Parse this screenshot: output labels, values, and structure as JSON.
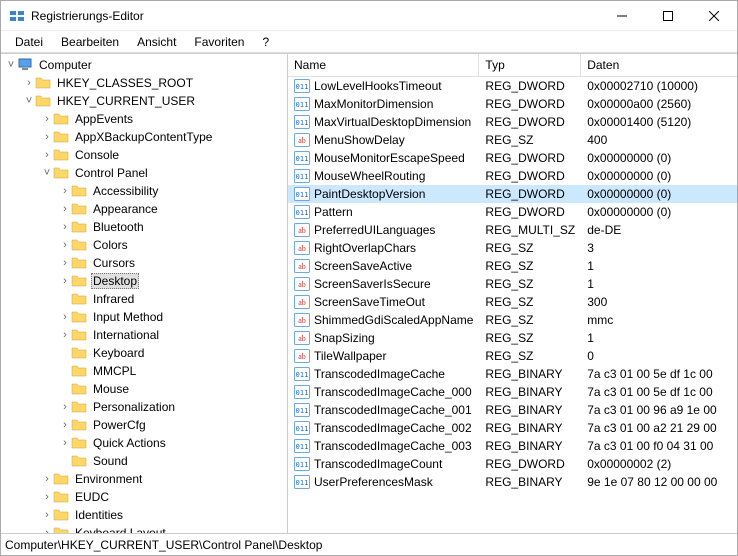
{
  "window": {
    "title": "Registrierungs-Editor"
  },
  "menubar": [
    "Datei",
    "Bearbeiten",
    "Ansicht",
    "Favoriten",
    "?"
  ],
  "tree": [
    {
      "depth": 0,
      "toggle": "˅",
      "icon": "computer",
      "label": "Computer"
    },
    {
      "depth": 1,
      "toggle": "›",
      "icon": "folder",
      "label": "HKEY_CLASSES_ROOT"
    },
    {
      "depth": 1,
      "toggle": "˅",
      "icon": "folder",
      "label": "HKEY_CURRENT_USER"
    },
    {
      "depth": 2,
      "toggle": "›",
      "icon": "folder",
      "label": "AppEvents"
    },
    {
      "depth": 2,
      "toggle": "›",
      "icon": "folder",
      "label": "AppXBackupContentType"
    },
    {
      "depth": 2,
      "toggle": "›",
      "icon": "folder",
      "label": "Console"
    },
    {
      "depth": 2,
      "toggle": "˅",
      "icon": "folder",
      "label": "Control Panel"
    },
    {
      "depth": 3,
      "toggle": "›",
      "icon": "folder",
      "label": "Accessibility"
    },
    {
      "depth": 3,
      "toggle": "›",
      "icon": "folder",
      "label": "Appearance"
    },
    {
      "depth": 3,
      "toggle": "›",
      "icon": "folder",
      "label": "Bluetooth"
    },
    {
      "depth": 3,
      "toggle": "›",
      "icon": "folder",
      "label": "Colors"
    },
    {
      "depth": 3,
      "toggle": "›",
      "icon": "folder",
      "label": "Cursors"
    },
    {
      "depth": 3,
      "toggle": "›",
      "icon": "folder",
      "label": "Desktop",
      "selected": true
    },
    {
      "depth": 3,
      "toggle": " ",
      "icon": "folder",
      "label": "Infrared"
    },
    {
      "depth": 3,
      "toggle": "›",
      "icon": "folder",
      "label": "Input Method"
    },
    {
      "depth": 3,
      "toggle": "›",
      "icon": "folder",
      "label": "International"
    },
    {
      "depth": 3,
      "toggle": " ",
      "icon": "folder",
      "label": "Keyboard"
    },
    {
      "depth": 3,
      "toggle": " ",
      "icon": "folder",
      "label": "MMCPL"
    },
    {
      "depth": 3,
      "toggle": " ",
      "icon": "folder",
      "label": "Mouse"
    },
    {
      "depth": 3,
      "toggle": "›",
      "icon": "folder",
      "label": "Personalization"
    },
    {
      "depth": 3,
      "toggle": "›",
      "icon": "folder",
      "label": "PowerCfg"
    },
    {
      "depth": 3,
      "toggle": "›",
      "icon": "folder",
      "label": "Quick Actions"
    },
    {
      "depth": 3,
      "toggle": " ",
      "icon": "folder",
      "label": "Sound"
    },
    {
      "depth": 2,
      "toggle": "›",
      "icon": "folder",
      "label": "Environment"
    },
    {
      "depth": 2,
      "toggle": "›",
      "icon": "folder",
      "label": "EUDC"
    },
    {
      "depth": 2,
      "toggle": "›",
      "icon": "folder",
      "label": "Identities"
    },
    {
      "depth": 2,
      "toggle": "›",
      "icon": "folder",
      "label": "Keyboard Layout"
    }
  ],
  "columns": {
    "name": "Name",
    "type": "Typ",
    "data": "Daten"
  },
  "values": [
    {
      "icon": "bin",
      "name": "LowLevelHooksTimeout",
      "type": "REG_DWORD",
      "data": "0x00002710 (10000)"
    },
    {
      "icon": "bin",
      "name": "MaxMonitorDimension",
      "type": "REG_DWORD",
      "data": "0x00000a00 (2560)"
    },
    {
      "icon": "bin",
      "name": "MaxVirtualDesktopDimension",
      "type": "REG_DWORD",
      "data": "0x00001400 (5120)"
    },
    {
      "icon": "str",
      "name": "MenuShowDelay",
      "type": "REG_SZ",
      "data": "400"
    },
    {
      "icon": "bin",
      "name": "MouseMonitorEscapeSpeed",
      "type": "REG_DWORD",
      "data": "0x00000000 (0)"
    },
    {
      "icon": "bin",
      "name": "MouseWheelRouting",
      "type": "REG_DWORD",
      "data": "0x00000000 (0)"
    },
    {
      "icon": "bin",
      "name": "PaintDesktopVersion",
      "type": "REG_DWORD",
      "data": "0x00000000 (0)",
      "selected": true
    },
    {
      "icon": "bin",
      "name": "Pattern",
      "type": "REG_DWORD",
      "data": "0x00000000 (0)"
    },
    {
      "icon": "str",
      "name": "PreferredUILanguages",
      "type": "REG_MULTI_SZ",
      "data": "de-DE"
    },
    {
      "icon": "str",
      "name": "RightOverlapChars",
      "type": "REG_SZ",
      "data": "3"
    },
    {
      "icon": "str",
      "name": "ScreenSaveActive",
      "type": "REG_SZ",
      "data": "1"
    },
    {
      "icon": "str",
      "name": "ScreenSaverIsSecure",
      "type": "REG_SZ",
      "data": "1"
    },
    {
      "icon": "str",
      "name": "ScreenSaveTimeOut",
      "type": "REG_SZ",
      "data": "300"
    },
    {
      "icon": "str",
      "name": "ShimmedGdiScaledAppName",
      "type": "REG_SZ",
      "data": "mmc"
    },
    {
      "icon": "str",
      "name": "SnapSizing",
      "type": "REG_SZ",
      "data": "1"
    },
    {
      "icon": "str",
      "name": "TileWallpaper",
      "type": "REG_SZ",
      "data": "0"
    },
    {
      "icon": "bin",
      "name": "TranscodedImageCache",
      "type": "REG_BINARY",
      "data": "7a c3 01 00 5e df 1c 00"
    },
    {
      "icon": "bin",
      "name": "TranscodedImageCache_000",
      "type": "REG_BINARY",
      "data": "7a c3 01 00 5e df 1c 00"
    },
    {
      "icon": "bin",
      "name": "TranscodedImageCache_001",
      "type": "REG_BINARY",
      "data": "7a c3 01 00 96 a9 1e 00"
    },
    {
      "icon": "bin",
      "name": "TranscodedImageCache_002",
      "type": "REG_BINARY",
      "data": "7a c3 01 00 a2 21 29 00"
    },
    {
      "icon": "bin",
      "name": "TranscodedImageCache_003",
      "type": "REG_BINARY",
      "data": "7a c3 01 00 f0 04 31 00"
    },
    {
      "icon": "bin",
      "name": "TranscodedImageCount",
      "type": "REG_DWORD",
      "data": "0x00000002 (2)"
    },
    {
      "icon": "bin",
      "name": "UserPreferencesMask",
      "type": "REG_BINARY",
      "data": "9e 1e 07 80 12 00 00 00"
    }
  ],
  "statusbar": "Computer\\HKEY_CURRENT_USER\\Control Panel\\Desktop"
}
